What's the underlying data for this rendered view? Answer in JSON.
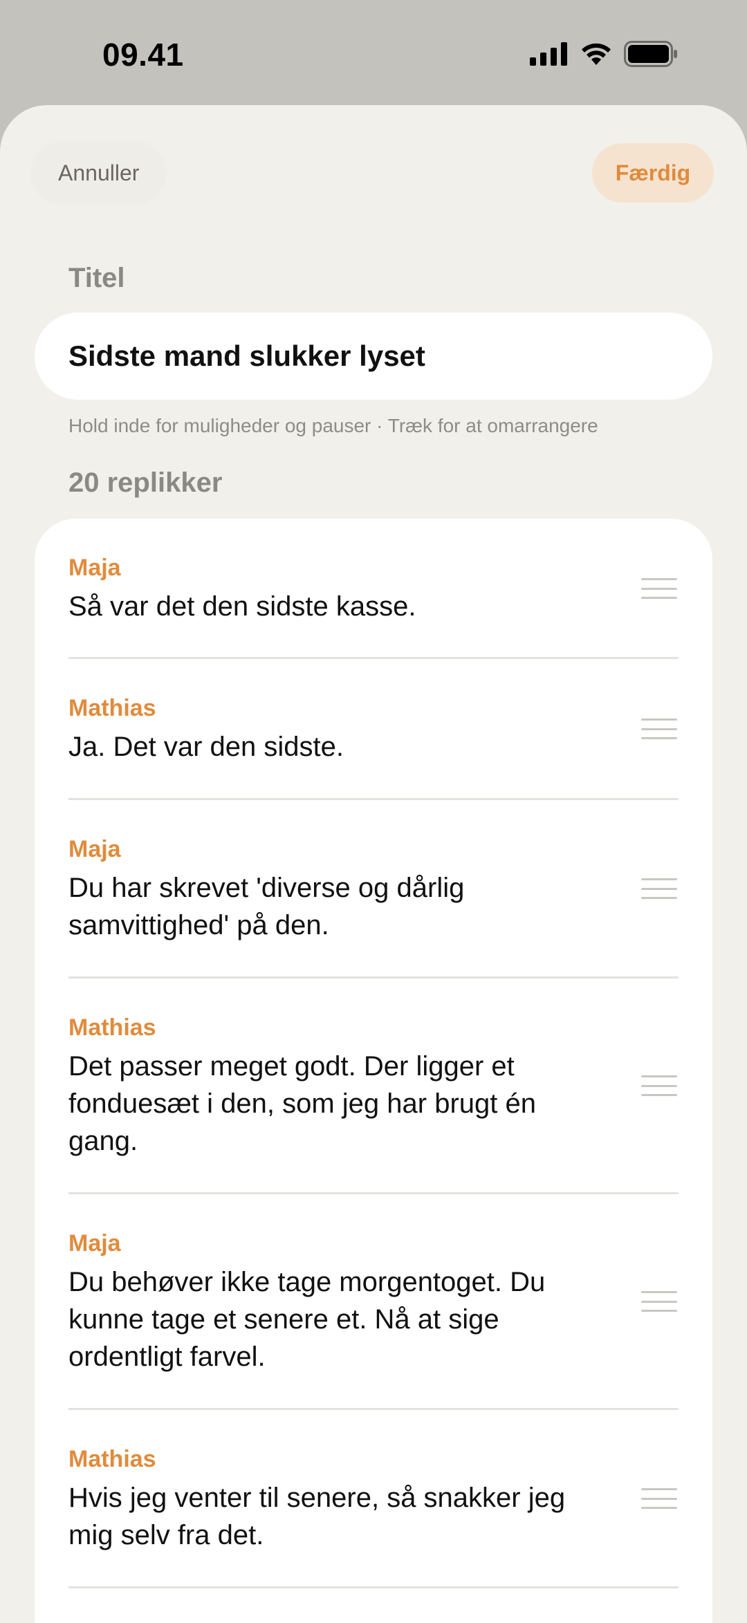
{
  "status": {
    "time": "09.41"
  },
  "toolbar": {
    "cancel_label": "Annuller",
    "done_label": "Færdig"
  },
  "title_section": {
    "label": "Titel",
    "value": "Sidste mand slukker lyset"
  },
  "hint": "Hold inde for muligheder og pauser · Træk for at omarrangere",
  "lines_section": {
    "count_label": "20 replikker"
  },
  "lines": [
    {
      "speaker": "Maja",
      "text": "Så var det den sidste kasse."
    },
    {
      "speaker": "Mathias",
      "text": "Ja. Det var den sidste."
    },
    {
      "speaker": "Maja",
      "text": "Du har skrevet 'diverse og dårlig samvittighed' på den."
    },
    {
      "speaker": "Mathias",
      "text": "Det passer meget godt. Der ligger et fonduesæt i den, som jeg har brugt én gang."
    },
    {
      "speaker": "Maja",
      "text": "Du behøver ikke tage morgentoget. Du kunne tage et senere et. Nå at sige ordentligt farvel."
    },
    {
      "speaker": "Mathias",
      "text": "Hvis jeg venter til senere, så snakker jeg mig selv fra det."
    }
  ],
  "colors": {
    "accent": "#e08b3c",
    "background": "#f2f0eb",
    "card": "#ffffff"
  }
}
